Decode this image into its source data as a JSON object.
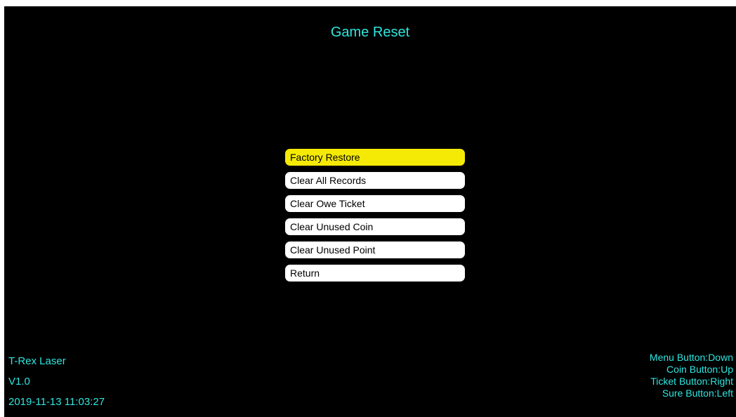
{
  "header": {
    "title": "Game Reset"
  },
  "menu": {
    "selected_index": 0,
    "items": [
      {
        "label": "Factory Restore"
      },
      {
        "label": "Clear All Records"
      },
      {
        "label": "Clear Owe Ticket"
      },
      {
        "label": "Clear Unused Coin"
      },
      {
        "label": "Clear Unused Point"
      },
      {
        "label": "Return"
      }
    ]
  },
  "info": {
    "game_name": "T-Rex Laser",
    "version": "V1.0",
    "datetime": "2019-11-13 11:03:27"
  },
  "controls": {
    "menu_button": "Menu Button:Down",
    "coin_button": "Coin Button:Up",
    "ticket_button": "Ticket Button:Right",
    "sure_button": "Sure Button:Left"
  },
  "colors": {
    "background": "#000000",
    "text_cyan": "#2ee6e0",
    "highlight_yellow": "#f5ea05",
    "item_white": "#ffffff"
  }
}
